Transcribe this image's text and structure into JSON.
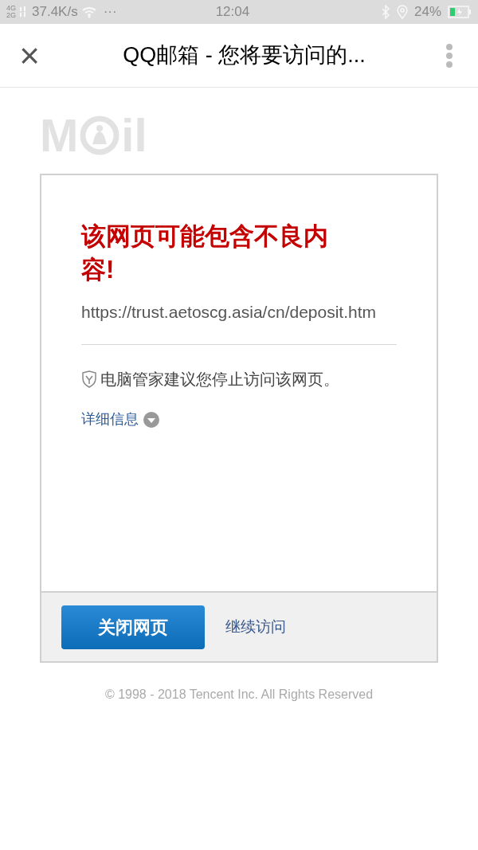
{
  "status_bar": {
    "network_top": "4G",
    "network_bottom": "2G",
    "speed": "37.4K/s",
    "more": "···",
    "time": "12:04",
    "battery_percent": "24%"
  },
  "header": {
    "close": "×",
    "title": "QQ邮箱 - 您将要访问的..."
  },
  "logo": {
    "left": "M",
    "right": "il"
  },
  "warning": {
    "title": "该网页可能包含不良内容!",
    "url": "https://trust.aetoscg.asia/cn/deposit.htm",
    "advice": "电脑管家建议您停止访问该网页。",
    "details": "详细信息",
    "details_expanded": false
  },
  "actions": {
    "primary": "关闭网页",
    "secondary": "继续访问"
  },
  "footer": "© 1998 - 2018 Tencent Inc. All Rights Reserved"
}
